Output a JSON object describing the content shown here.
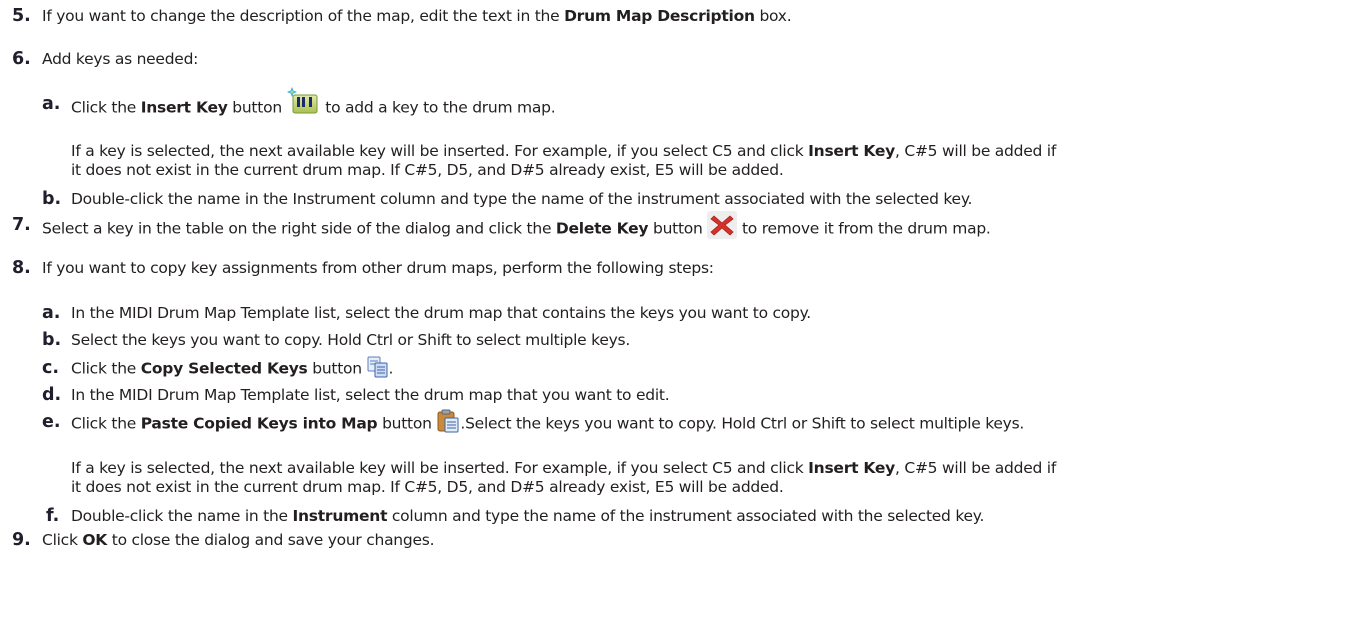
{
  "steps": {
    "s5": {
      "num": "5.",
      "t1": "If you want to change the description of the map, edit the text in the ",
      "b1": "Drum Map Description",
      "t2": " box."
    },
    "s6": {
      "num": "6.",
      "text": "Add keys as needed:",
      "a": {
        "letter": "a.",
        "t1": "Click the ",
        "b1": "Insert Key",
        "t2": " button",
        "t3": " to add a key to the drum map.",
        "icon": "insert-key-icon",
        "note1_t1": "If a key is selected, the next available key will be inserted. For example, if you select C5 and click ",
        "note1_b1": "Insert Key",
        "note1_t2": ", C#5 will be added if",
        "note2": "it does not exist in the current drum map. If C#5, D5, and D#5 already exist, E5 will be added."
      },
      "b": {
        "letter": "b.",
        "text": "Double-click the name in the Instrument column and type the name of the instrument associated with the selected key."
      }
    },
    "s7": {
      "num": "7.",
      "t1": "Select a key in the table on the right side of the dialog and click the ",
      "b1": "Delete Key",
      "t2": " button",
      "t3": " to remove it from the drum map.",
      "icon": "delete-key-icon"
    },
    "s8": {
      "num": "8.",
      "text": "If you want to copy key assignments from other drum maps, perform the following steps:",
      "a": {
        "letter": "a.",
        "text": "In the MIDI Drum Map Template list, select the drum map that contains the keys you want to copy."
      },
      "b": {
        "letter": "b.",
        "text": "Select the keys you want to copy. Hold Ctrl or Shift to select multiple keys."
      },
      "c": {
        "letter": "c.",
        "t1": "Click the ",
        "b1": "Copy Selected Keys",
        "t2": " button",
        "t3": ".",
        "icon": "copy-keys-icon"
      },
      "d": {
        "letter": "d.",
        "text": "In the MIDI Drum Map Template list, select the drum map that you want to edit."
      },
      "e": {
        "letter": "e.",
        "t1": "Click the ",
        "b1": "Paste Copied Keys into Map",
        "t2": " button",
        "t3": ".Select the keys you want to copy. Hold Ctrl or Shift to select multiple keys.",
        "icon": "paste-keys-icon",
        "note1_t1": "If a key is selected, the next available key will be inserted. For example, if you select C5 and click ",
        "note1_b1": "Insert Key",
        "note1_t2": ", C#5 will be added if",
        "note2": "it does not exist in the current drum map. If C#5, D5, and D#5 already exist, E5 will be added."
      },
      "f": {
        "letter": "f.",
        "t1": "Double-click the name in the ",
        "b1": "Instrument",
        "t2": " column and type the name of the instrument associated with the selected key."
      }
    },
    "s9": {
      "num": "9.",
      "t1": "Click ",
      "b1": "OK",
      "t2": " to close the dialog and save your changes."
    }
  },
  "colors": {
    "text": "#231f20",
    "number": "#1f1f2e",
    "delete_icon": "#d6322b"
  }
}
